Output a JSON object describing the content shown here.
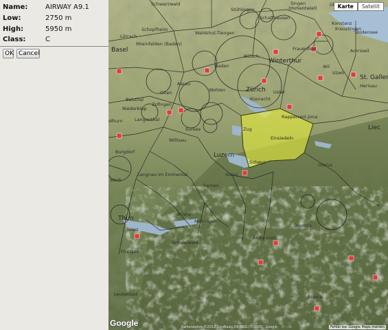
{
  "info": {
    "name_label": "Name:",
    "name_value": "AIRWAY A9.1",
    "low_label": "Low:",
    "low_value": "2750 m",
    "high_label": "High:",
    "high_value": "5950 m",
    "class_label": "Class:",
    "class_value": "C"
  },
  "buttons": {
    "ok": "OK",
    "cancel": "Cancel"
  },
  "map": {
    "type_control": {
      "karte": "Karte",
      "satellit": "Satellit",
      "active": "Karte"
    },
    "logo": "Google",
    "copyright": "Kartendaten ©2012 GeoBasis-DE/BKG (©2009), Google",
    "report": "Fehler bei Google Maps melden",
    "labels": {
      "schwarzwald": "Schwarzwald",
      "singen": "Singen",
      "hohentwiel": "(Hohentwiel)",
      "uberlingen": "Überl",
      "stuhlingen": "Stühlingen",
      "schaffhausen": "Schaffhausen",
      "konstanz": "Konstanz",
      "kreuzlingen": "Kreuzlingen",
      "lorrach": "Lörrach",
      "schopfheim": "Schopfheim",
      "waldshut": "Waldshut-Tiengen",
      "frauenfeld": "Frauenfeld",
      "bodensee": "Bodensee",
      "basel": "Basel",
      "rheinfelden": "Rheinfelden (Baden)",
      "bulach": "Bülach",
      "winterthur": "Winterthur",
      "amriswil": "Amriswil",
      "baden": "Baden",
      "wil": "Wil",
      "uzwil": "Uzwil",
      "stgallen": "St. Gallen",
      "aarau": "Aarau",
      "wohlen": "Wohlen",
      "zurich": "Zürich",
      "uster": "Uster",
      "herisau": "Herisau",
      "olten": "Olten",
      "zofingen": "Zofingen",
      "kussnacht": "Küsnacht",
      "rapperswil": "Rapperswil-Jona",
      "balsthal": "Balsthal",
      "niederbipp": "Niederbipp",
      "langenthal": "Langenthal",
      "sursee": "Sursee",
      "zug": "Zug",
      "lie": "Liec",
      "solothurn": "olhurn",
      "einsiedeln": "Einsiedeln",
      "willisau": "Willisau",
      "burgdorf": "Burgdorf",
      "luzern": "Luzern",
      "schwyz": "Schwyz",
      "glarus": "Glarus",
      "langnau": "Langnau im Emmental",
      "worb": "Worb",
      "sarnen": "Sarnen",
      "stans": "Stans",
      "thun": "Thun",
      "brienz": "Brienz",
      "meiringen": "Meiringen",
      "spiez": "Spiez",
      "andermatt": "Andermatt",
      "grindelwald": "Grindelwald",
      "frutigen": "Frutigen",
      "disentis": "Disentis",
      "leukerbad": "Leukerbad",
      "biasca": "Biasca"
    }
  },
  "colors": {
    "airspace_fill": "#e8ee3a",
    "airspace_stroke": "#3a3a10",
    "border": "#1a1a1a",
    "route_marker": "#e23b3b"
  }
}
